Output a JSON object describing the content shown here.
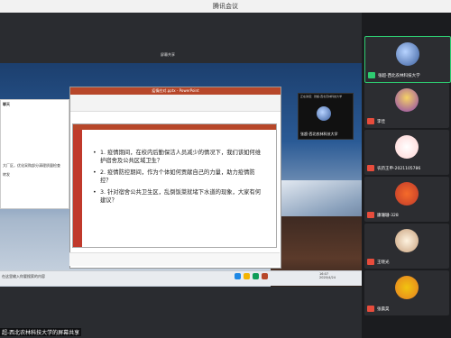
{
  "window": {
    "title": "腾讯会议"
  },
  "share_area": {
    "share_tag": "屏幕共享",
    "caption": "超-西北农林科技大学的屏幕共享"
  },
  "taskbar": {
    "search_placeholder": "在这里输入你要搜索的内容",
    "clock_time": "16:07",
    "clock_date": "2020/4/24"
  },
  "left_panel": {
    "title": "聊天",
    "line1": "大厂区，优化采购部分清理质量检查",
    "line2": "转发"
  },
  "ppt": {
    "title": "疫情应对.pptx - PowerPoint",
    "slide_bullets": [
      "1. 疫情期间，在校内后勤保洁人员减少的情况下，我们该如何维护宿舍及公共区域卫生？",
      "2. 疫情防控期间，作为个体如何贡献自己的力量，助力疫情防控？",
      "3. 针对宿舍公共卫生区，乱倒饭菜就堵下水道的现象，大家有何建议？"
    ]
  },
  "mini_panel": {
    "title": "正在讲话：张超-西北农林科技大学",
    "name": "张超-西北农林科技大学"
  },
  "participants": [
    {
      "name": "张超-西北农林科技大学",
      "mic_muted": false
    },
    {
      "name": "李佳",
      "mic_muted": true
    },
    {
      "name": "农药王申-2021105786",
      "mic_muted": true
    },
    {
      "name": "康珊珊-328",
      "mic_muted": true
    },
    {
      "name": "王晓光",
      "mic_muted": true
    },
    {
      "name": "张晨昊",
      "mic_muted": true
    }
  ],
  "colors": {
    "accent_green": "#2ecc71",
    "mute_red": "#e74c3c",
    "ppt_red": "#b7472a"
  }
}
